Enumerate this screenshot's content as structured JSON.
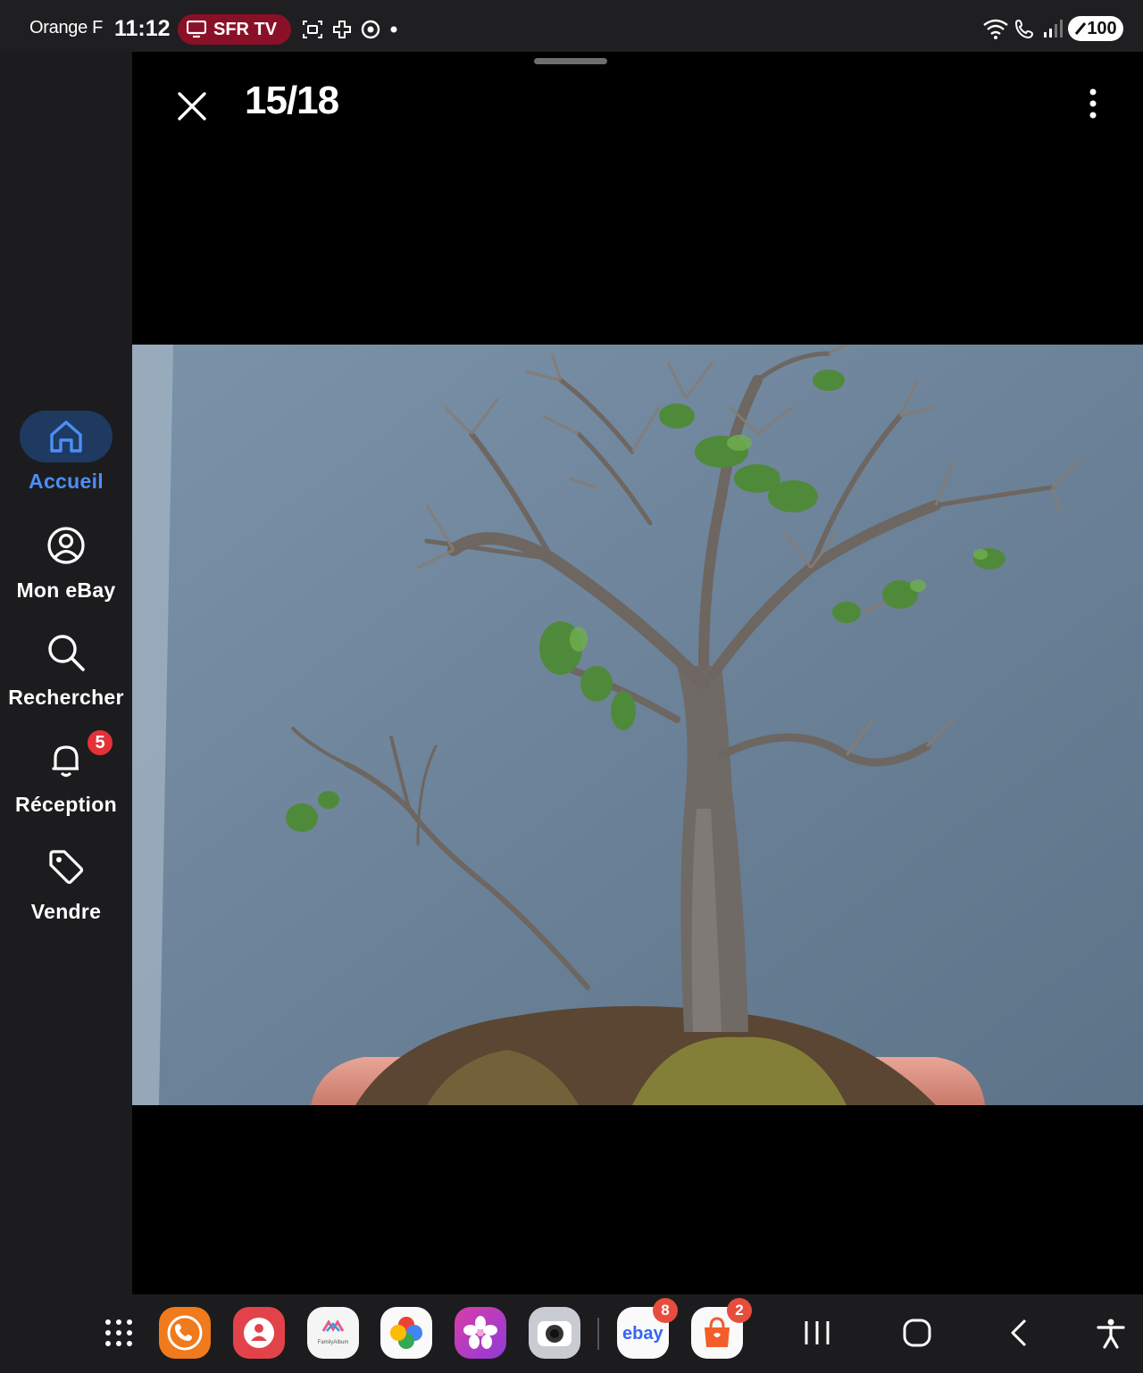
{
  "status_bar": {
    "carrier": "Orange F",
    "time": "11:12",
    "cast_label": "SFR TV",
    "battery": "100"
  },
  "viewer": {
    "counter": "15/18"
  },
  "nav": {
    "items": [
      {
        "label": "Accueil",
        "icon": "home-icon",
        "active": true
      },
      {
        "label": "Mon eBay",
        "icon": "profile-icon"
      },
      {
        "label": "Rechercher",
        "icon": "search-icon"
      },
      {
        "label": "Réception",
        "icon": "bell-icon",
        "badge": "5"
      },
      {
        "label": "Vendre",
        "icon": "tag-icon"
      }
    ]
  },
  "dock": {
    "apps": [
      {
        "name": "app-drawer-icon"
      },
      {
        "name": "phone-app-icon",
        "color": "#f07a1c"
      },
      {
        "name": "contacts-app-icon",
        "color": "#e2434a"
      },
      {
        "name": "family-album-app-icon",
        "label": "FamilyAlbum"
      },
      {
        "name": "google-photos-app-icon"
      },
      {
        "name": "gallery-app-icon",
        "color": "#e63aa8"
      },
      {
        "name": "camera-app-icon",
        "color": "#c8ccd2"
      },
      {
        "name": "ebay-app-icon",
        "label": "ebay",
        "badge": "8"
      },
      {
        "name": "shop-app-icon",
        "color": "#f25d2a",
        "badge": "2"
      }
    ]
  },
  "colors": {
    "accent": "#4d8df7",
    "active_pill": "#1e3a61",
    "badge": "#e53238",
    "cast_pill": "#8a1028"
  }
}
